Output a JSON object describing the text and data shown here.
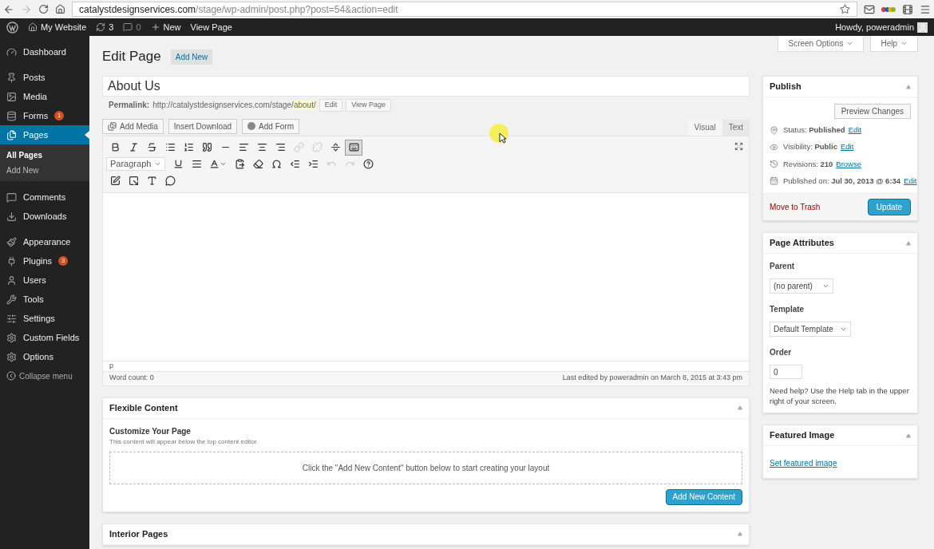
{
  "browser": {
    "url_host": "catalystdesignservices.com",
    "url_path": "/stage/wp-admin/post.php?post=54&action=edit"
  },
  "admin_bar": {
    "site": "My Website",
    "updates": "3",
    "comments": "0",
    "new": "New",
    "view": "View Page",
    "howdy": "Howdy, poweradmin"
  },
  "sidebar": {
    "items": [
      {
        "kind": "dashboard",
        "label": "Dashboard",
        "selected": false
      },
      {
        "kind": "posts",
        "label": "Posts",
        "selected": false
      },
      {
        "kind": "media",
        "label": "Media",
        "selected": false
      },
      {
        "kind": "forms",
        "label": "Forms",
        "badge": "1",
        "selected": false
      },
      {
        "kind": "pages",
        "label": "Pages",
        "selected": true,
        "children": [
          {
            "label": "All Pages",
            "selected": true
          },
          {
            "label": "Add New",
            "selected": false
          }
        ]
      },
      {
        "kind": "comments",
        "label": "Comments",
        "selected": false
      },
      {
        "kind": "downloads",
        "label": "Downloads",
        "selected": false
      },
      {
        "kind": "appearance",
        "label": "Appearance",
        "selected": false
      },
      {
        "kind": "plugins",
        "label": "Plugins",
        "badge": "3",
        "selected": false
      },
      {
        "kind": "users",
        "label": "Users",
        "selected": false
      },
      {
        "kind": "tools",
        "label": "Tools",
        "selected": false
      },
      {
        "kind": "settings",
        "label": "Settings",
        "selected": false
      },
      {
        "kind": "custom_fields",
        "label": "Custom Fields",
        "selected": false
      },
      {
        "kind": "options",
        "label": "Options",
        "selected": false
      }
    ],
    "collapse": "Collapse menu"
  },
  "screen_tabs": [
    "Screen Options",
    "Help"
  ],
  "heading": {
    "title": "Edit Page",
    "add_new": "Add New"
  },
  "post": {
    "title": "About Us",
    "permalink_label": "Permalink:",
    "permalink_base": "http://catalystdesignservices.com/stage/",
    "permalink_slug": "about/",
    "edit": "Edit",
    "view": "View Page"
  },
  "media_buttons": [
    {
      "kind": "media",
      "label": "Add Media"
    },
    {
      "kind": "plain",
      "label": "Insert Download"
    },
    {
      "kind": "form",
      "label": "Add Form"
    }
  ],
  "editor_tabs": [
    {
      "label": "Visual",
      "selected": true
    },
    {
      "label": "Text",
      "selected": false
    }
  ],
  "toolbar_rows": [
    [
      {
        "kind": "bold",
        "disabled": false,
        "selected": false
      },
      {
        "kind": "italic",
        "disabled": false,
        "selected": false
      },
      {
        "kind": "strike",
        "disabled": false,
        "selected": false
      },
      {
        "kind": "bullets",
        "disabled": false,
        "selected": false
      },
      {
        "kind": "numbers",
        "disabled": false,
        "selected": false
      },
      {
        "kind": "quote",
        "disabled": false,
        "selected": false
      },
      {
        "kind": "rule",
        "disabled": false,
        "selected": false
      },
      {
        "kind": "align_left",
        "disabled": false,
        "selected": false
      },
      {
        "kind": "align_center",
        "disabled": false,
        "selected": false
      },
      {
        "kind": "align_right",
        "disabled": false,
        "selected": false
      },
      {
        "kind": "link",
        "disabled": true,
        "selected": false
      },
      {
        "kind": "unlink",
        "disabled": true,
        "selected": false
      },
      {
        "kind": "more",
        "disabled": false,
        "selected": false
      },
      {
        "kind": "kitchen_sink",
        "disabled": false,
        "selected": true
      }
    ],
    [
      {
        "kind": "format_select",
        "label": "Paragraph"
      },
      {
        "kind": "underline",
        "disabled": false,
        "selected": false
      },
      {
        "kind": "justify",
        "disabled": false,
        "selected": false
      },
      {
        "kind": "text_color",
        "disabled": false,
        "selected": false
      },
      {
        "kind": "paste_text",
        "disabled": false,
        "selected": false
      },
      {
        "kind": "clear",
        "disabled": false,
        "selected": false
      },
      {
        "kind": "omega",
        "disabled": false,
        "selected": false
      },
      {
        "kind": "outdent",
        "disabled": false,
        "selected": false
      },
      {
        "kind": "indent",
        "disabled": false,
        "selected": false
      },
      {
        "kind": "undo",
        "disabled": true,
        "selected": false
      },
      {
        "kind": "redo",
        "disabled": true,
        "selected": false
      },
      {
        "kind": "help",
        "disabled": false,
        "selected": false
      }
    ],
    [
      {
        "kind": "edit_box",
        "disabled": false,
        "selected": false
      },
      {
        "kind": "edit_out",
        "disabled": false,
        "selected": false
      },
      {
        "kind": "type",
        "disabled": false,
        "selected": false
      },
      {
        "kind": "bubble",
        "disabled": false,
        "selected": false
      }
    ]
  ],
  "editor_status": {
    "path": "p",
    "word_count": "Word count: 0",
    "last_edited": "Last edited by poweradmin on March 8, 2015 at 3:43 pm"
  },
  "flexible": {
    "title": "Flexible Content",
    "subtitle": "Customize Your Page",
    "note": "This content will appear below the top content editor.",
    "empty": "Click the \"Add New Content\" button below to start creating your layout",
    "button": "Add New Content"
  },
  "interior": {
    "title": "Interior Pages"
  },
  "publish": {
    "title": "Publish",
    "preview": "Preview Changes",
    "rows": [
      {
        "kind": "status",
        "text": "Status: **Published**",
        "link": "Edit"
      },
      {
        "kind": "visibility",
        "text": "Visibility: **Public**",
        "link": "Edit"
      },
      {
        "kind": "revisions",
        "text": "Revisions: **210**",
        "link": "Browse"
      },
      {
        "kind": "date",
        "text": "Published on: **Jul 30, 2013 @ 6:34**",
        "link": "Edit"
      }
    ],
    "trash": "Move to Trash",
    "update": "Update"
  },
  "attributes": {
    "title": "Page Attributes",
    "parent_label": "Parent",
    "parent": "(no parent)",
    "template_label": "Template",
    "template": "Default Template",
    "order_label": "Order",
    "order": "0",
    "help": "Need help? Use the Help tab in the upper right of your screen."
  },
  "featured": {
    "title": "Featured Image",
    "link": "Set featured image"
  }
}
